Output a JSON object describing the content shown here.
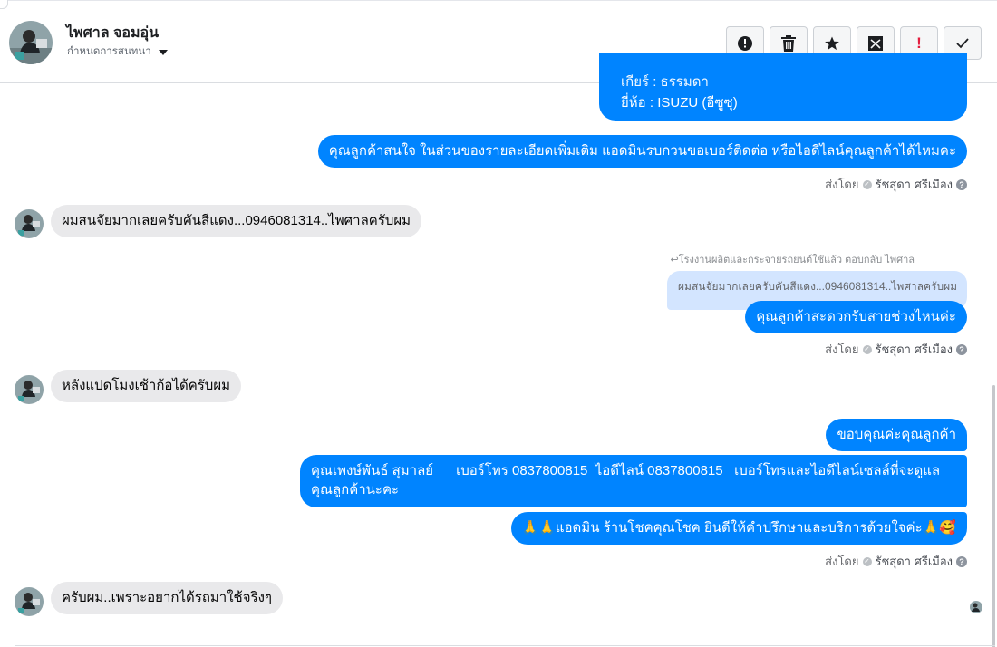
{
  "header": {
    "contact_name": "ไพศาล จอมอุ่น",
    "conversation_settings": "กำหนดการสนทนา"
  },
  "actions": [
    {
      "name": "mark-spam-button",
      "icon": "alert-circle-icon"
    },
    {
      "name": "delete-button",
      "icon": "trash-icon"
    },
    {
      "name": "star-button",
      "icon": "star-icon"
    },
    {
      "name": "archive-button",
      "icon": "archive-box-icon"
    },
    {
      "name": "priority-button",
      "icon": "exclamation-icon",
      "text": "!"
    },
    {
      "name": "mark-done-button",
      "icon": "checkmark-icon"
    }
  ],
  "messages": {
    "m1_line1": "เกียร์ : ธรรมดา",
    "m1_line2": "ยี่ห้อ : ISUZU (อีซูซุ)",
    "m2": "คุณลูกค้าสนใจ ในส่วนของรายละเอียดเพิ่มเติม แอดมินรบกวนขอเบอร์ติดต่อ หรือไอดีไลน์คุณลูกค้าได้ไหมคะ",
    "in1": "ผมสนจัยมากเลยครับคันสีแดง...0946081314..ไพศาลครับผม",
    "reply_note": "โรงงานผลิตและกระจายรถยนต์ใช้แล้ว ตอบกลับ ไพศาล",
    "quoted": "ผมสนจัยมากเลยครับคันสีแดง...0946081314..ไพศาลครับผม",
    "m3": "คุณลูกค้าสะดวกรับสายช่วงไหนค่ะ",
    "in2": "หลังแปดโมงเช้าก้อได้ครับผม",
    "m4": "ขอบคุณค่ะคุณลูกค้า",
    "m5_line1": "คุณเพงษ์พันธ์ สุมาลย์      เบอร์โทร 0837800815  ไอดีไลน์ 0837800815   เบอร์โทรและไอดีไลน์เซลล์ที่จะดูแล",
    "m5_line2": "คุณลูกค้านะคะ",
    "m6": "🙏🙏แอดมิน ร้านโชคคุณโชค ยินดีให้คำปรึกษาและบริการด้วยใจค่ะ🙏🥰",
    "in3": "ครับผม..เพราะอยากได้รถมาใช้จริงๆ"
  },
  "sent_by": {
    "prefix": "ส่งโดย",
    "agent": "รัชสุดา ศรีเมือง",
    "help": "?"
  },
  "colors": {
    "outgoing_bubble": "#0084ff",
    "incoming_bubble": "#e9e9eb",
    "quoted_bubble": "#d3e5ff",
    "priority": "#e41e3f"
  }
}
